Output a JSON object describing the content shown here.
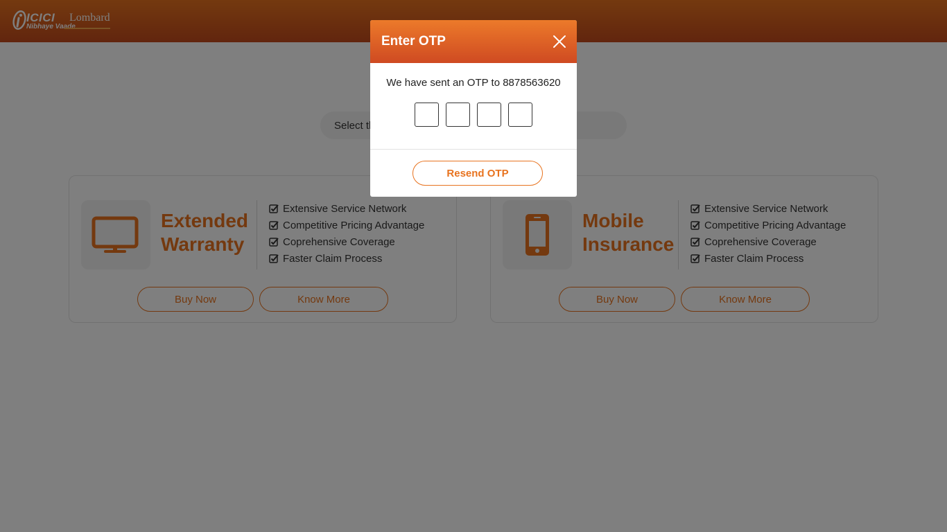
{
  "header": {
    "brand": "ICICI",
    "brand_name": "Lombard",
    "tagline": "Nibhaye Vaade"
  },
  "intro": {
    "text": "Select the product that suits your need"
  },
  "products": [
    {
      "title_line1": "Extended",
      "title_line2": "Warranty",
      "icon": "monitor-icon",
      "features": [
        "Extensive Service Network",
        "Competitive Pricing Advantage",
        "Coprehensive Coverage",
        "Faster Claim Process"
      ],
      "buy_label": "Buy Now",
      "know_label": "Know More"
    },
    {
      "title_line1": "Mobile",
      "title_line2": "Insurance",
      "icon": "mobile-phone-icon",
      "features": [
        "Extensive Service Network",
        "Competitive Pricing Advantage",
        "Coprehensive Coverage",
        "Faster Claim Process"
      ],
      "buy_label": "Buy Now",
      "know_label": "Know More"
    }
  ],
  "modal": {
    "title": "Enter OTP",
    "message": "We have sent an OTP to 8878563620",
    "otp_values": [
      "",
      "",
      "",
      ""
    ],
    "resend_label": "Resend OTP"
  },
  "colors": {
    "accent": "#e8731f",
    "header_dark": "#c44a1c"
  }
}
